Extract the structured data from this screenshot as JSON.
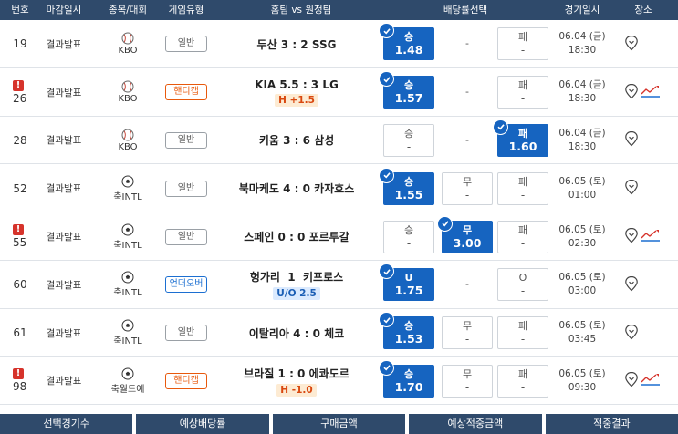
{
  "headers": [
    "번호",
    "마감일시",
    "종목/대회",
    "게임유형",
    "홈팀 vs 원정팀",
    "배당률선택",
    "경기일시",
    "장소"
  ],
  "rows": [
    {
      "num": "19",
      "alert": false,
      "deadline": "결과발표",
      "sport": "KBO",
      "sport_icon": "baseball",
      "gtype": "일반",
      "gclass": "",
      "match": "두산 3 : 2 SSG",
      "sub": "",
      "subclass": "",
      "odds": [
        {
          "label": "승",
          "val": "1.48",
          "sel": true
        },
        {
          "label": "-",
          "val": "",
          "sel": false,
          "dash": true
        },
        {
          "label": "패",
          "val": "-",
          "sel": false
        }
      ],
      "date": "06.04 (금)",
      "time": "18:30",
      "chart": false
    },
    {
      "num": "26",
      "alert": true,
      "deadline": "결과발표",
      "sport": "KBO",
      "sport_icon": "baseball",
      "gtype": "핸디캡",
      "gclass": "handicap",
      "match": "KIA 5.5 : 3 LG",
      "sub": "H +1.5",
      "subclass": "orange",
      "odds": [
        {
          "label": "승",
          "val": "1.57",
          "sel": true
        },
        {
          "label": "-",
          "val": "",
          "sel": false,
          "dash": true
        },
        {
          "label": "패",
          "val": "-",
          "sel": false
        }
      ],
      "date": "06.04 (금)",
      "time": "18:30",
      "chart": true
    },
    {
      "num": "28",
      "alert": false,
      "deadline": "결과발표",
      "sport": "KBO",
      "sport_icon": "baseball",
      "gtype": "일반",
      "gclass": "",
      "match": "키움 3 : 6 삼성",
      "sub": "",
      "subclass": "",
      "odds": [
        {
          "label": "승",
          "val": "-",
          "sel": false
        },
        {
          "label": "-",
          "val": "",
          "sel": false,
          "dash": true
        },
        {
          "label": "패",
          "val": "1.60",
          "sel": true
        }
      ],
      "date": "06.04 (금)",
      "time": "18:30",
      "chart": false
    },
    {
      "num": "52",
      "alert": false,
      "deadline": "결과발표",
      "sport": "축INTL",
      "sport_icon": "soccer",
      "gtype": "일반",
      "gclass": "",
      "match": "북마케도 4 : 0 카자흐스",
      "sub": "",
      "subclass": "",
      "odds": [
        {
          "label": "승",
          "val": "1.55",
          "sel": true
        },
        {
          "label": "무",
          "val": "-",
          "sel": false
        },
        {
          "label": "패",
          "val": "-",
          "sel": false
        }
      ],
      "date": "06.05 (토)",
      "time": "01:00",
      "chart": false
    },
    {
      "num": "55",
      "alert": true,
      "deadline": "결과발표",
      "sport": "축INTL",
      "sport_icon": "soccer",
      "gtype": "일반",
      "gclass": "",
      "match": "스페인 0 : 0 포르투갈",
      "sub": "",
      "subclass": "",
      "odds": [
        {
          "label": "승",
          "val": "-",
          "sel": false
        },
        {
          "label": "무",
          "val": "3.00",
          "sel": true
        },
        {
          "label": "패",
          "val": "-",
          "sel": false
        }
      ],
      "date": "06.05 (토)",
      "time": "02:30",
      "chart": true
    },
    {
      "num": "60",
      "alert": false,
      "deadline": "결과발표",
      "sport": "축INTL",
      "sport_icon": "soccer",
      "gtype": "언더오버",
      "gclass": "overunder",
      "match": "헝가리  1  키프로스",
      "sub": "U/O 2.5",
      "subclass": "blue",
      "odds": [
        {
          "label": "U",
          "val": "1.75",
          "sel": true
        },
        {
          "label": "-",
          "val": "",
          "sel": false,
          "dash": true
        },
        {
          "label": "O",
          "val": "-",
          "sel": false
        }
      ],
      "date": "06.05 (토)",
      "time": "03:00",
      "chart": false
    },
    {
      "num": "61",
      "alert": false,
      "deadline": "결과발표",
      "sport": "축INTL",
      "sport_icon": "soccer",
      "gtype": "일반",
      "gclass": "",
      "match": "이탈리아 4 : 0 체코",
      "sub": "",
      "subclass": "",
      "odds": [
        {
          "label": "승",
          "val": "1.53",
          "sel": true
        },
        {
          "label": "무",
          "val": "-",
          "sel": false
        },
        {
          "label": "패",
          "val": "-",
          "sel": false
        }
      ],
      "date": "06.05 (토)",
      "time": "03:45",
      "chart": false
    },
    {
      "num": "98",
      "alert": true,
      "deadline": "결과발표",
      "sport": "축월드예",
      "sport_icon": "soccer",
      "gtype": "핸디캡",
      "gclass": "handicap",
      "match": "브라질 1 : 0 에콰도르",
      "sub": "H -1.0",
      "subclass": "orange",
      "odds": [
        {
          "label": "승",
          "val": "1.70",
          "sel": true
        },
        {
          "label": "무",
          "val": "-",
          "sel": false
        },
        {
          "label": "패",
          "val": "-",
          "sel": false
        }
      ],
      "date": "06.05 (토)",
      "time": "09:30",
      "chart": true
    }
  ],
  "alert_mark": "!",
  "footer": [
    "선택경기수",
    "예상배당률",
    "구매금액",
    "예상적중금액",
    "적중결과"
  ],
  "colors": {
    "header_bg": "#2f4a6b",
    "selected": "#1664c0",
    "handicap": "#e8590c",
    "overunder": "#1c6fd1"
  }
}
